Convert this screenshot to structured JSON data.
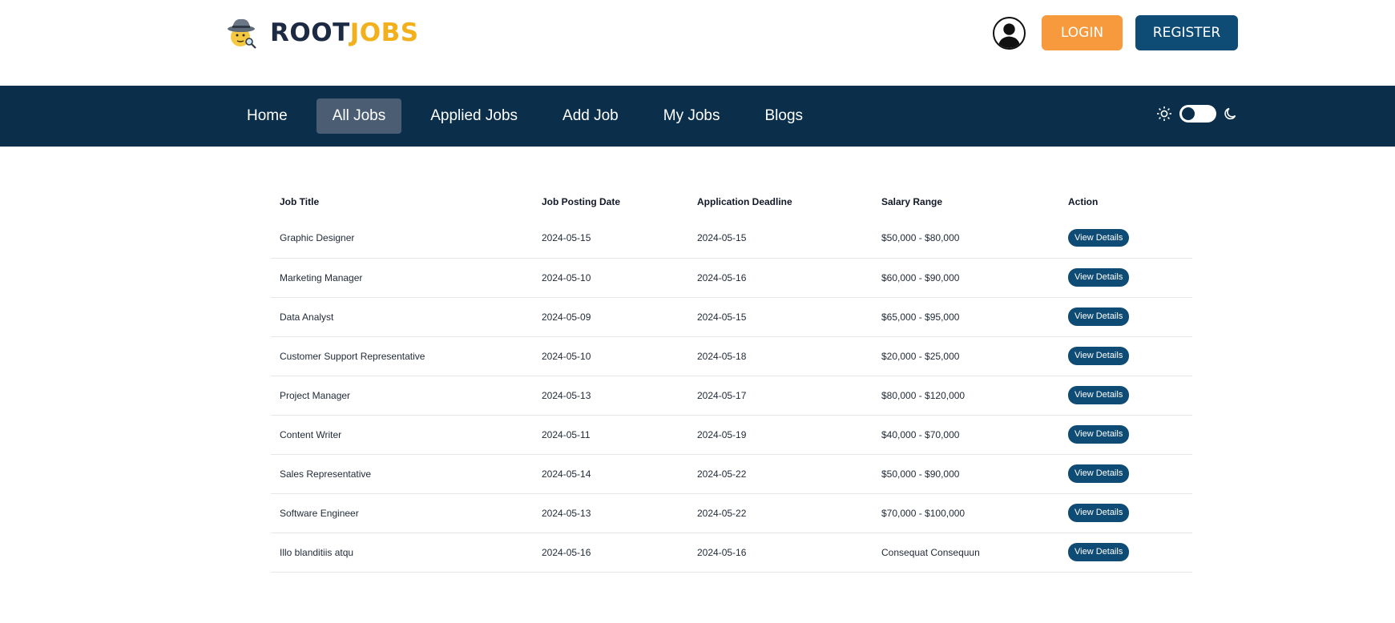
{
  "header": {
    "brand_part1": "ROOT",
    "brand_part2": "JOBS",
    "brand_icon": "detective-icon",
    "avatar_icon": "user-silhouette-icon",
    "login_label": "LOGIN",
    "register_label": "REGISTER"
  },
  "nav": {
    "items": [
      {
        "label": "Home",
        "active": false
      },
      {
        "label": "All Jobs",
        "active": true
      },
      {
        "label": "Applied Jobs",
        "active": false
      },
      {
        "label": "Add Job",
        "active": false
      },
      {
        "label": "My Jobs",
        "active": false
      },
      {
        "label": "Blogs",
        "active": false
      }
    ],
    "theme_toggle": {
      "light_icon": "sun-icon",
      "dark_icon": "moon-icon",
      "state": "light"
    }
  },
  "table": {
    "columns": [
      "Job Title",
      "Job Posting Date",
      "Application Deadline",
      "Salary Range",
      "Action"
    ],
    "action_label": "View Details",
    "rows": [
      [
        "Graphic Designer",
        "2024-05-15",
        "2024-05-15",
        "$50,000 - $80,000"
      ],
      [
        "Marketing Manager",
        "2024-05-10",
        "2024-05-16",
        "$60,000 - $90,000"
      ],
      [
        "Data Analyst",
        "2024-05-09",
        "2024-05-15",
        "$65,000 - $95,000"
      ],
      [
        "Customer Support Representative",
        "2024-05-10",
        "2024-05-18",
        "$20,000 - $25,000"
      ],
      [
        "Project Manager",
        "2024-05-13",
        "2024-05-17",
        "$80,000 - $120,000"
      ],
      [
        "Content Writer",
        "2024-05-11",
        "2024-05-19",
        "$40,000 - $70,000"
      ],
      [
        "Sales Representative",
        "2024-05-14",
        "2024-05-22",
        "$50,000 - $90,000"
      ],
      [
        "Software Engineer",
        "2024-05-13",
        "2024-05-22",
        "$70,000 - $100,000"
      ],
      [
        "Illo blanditiis atqu",
        "2024-05-16",
        "2024-05-16",
        "Consequat Consequun"
      ]
    ]
  },
  "colors": {
    "brand_dark": "#1d2a44",
    "brand_accent": "#f2b01c",
    "nav_bg": "#0b2f4b",
    "nav_active": "#4a5d73",
    "login_bg": "#f79a3e",
    "primary": "#0f4c75"
  }
}
